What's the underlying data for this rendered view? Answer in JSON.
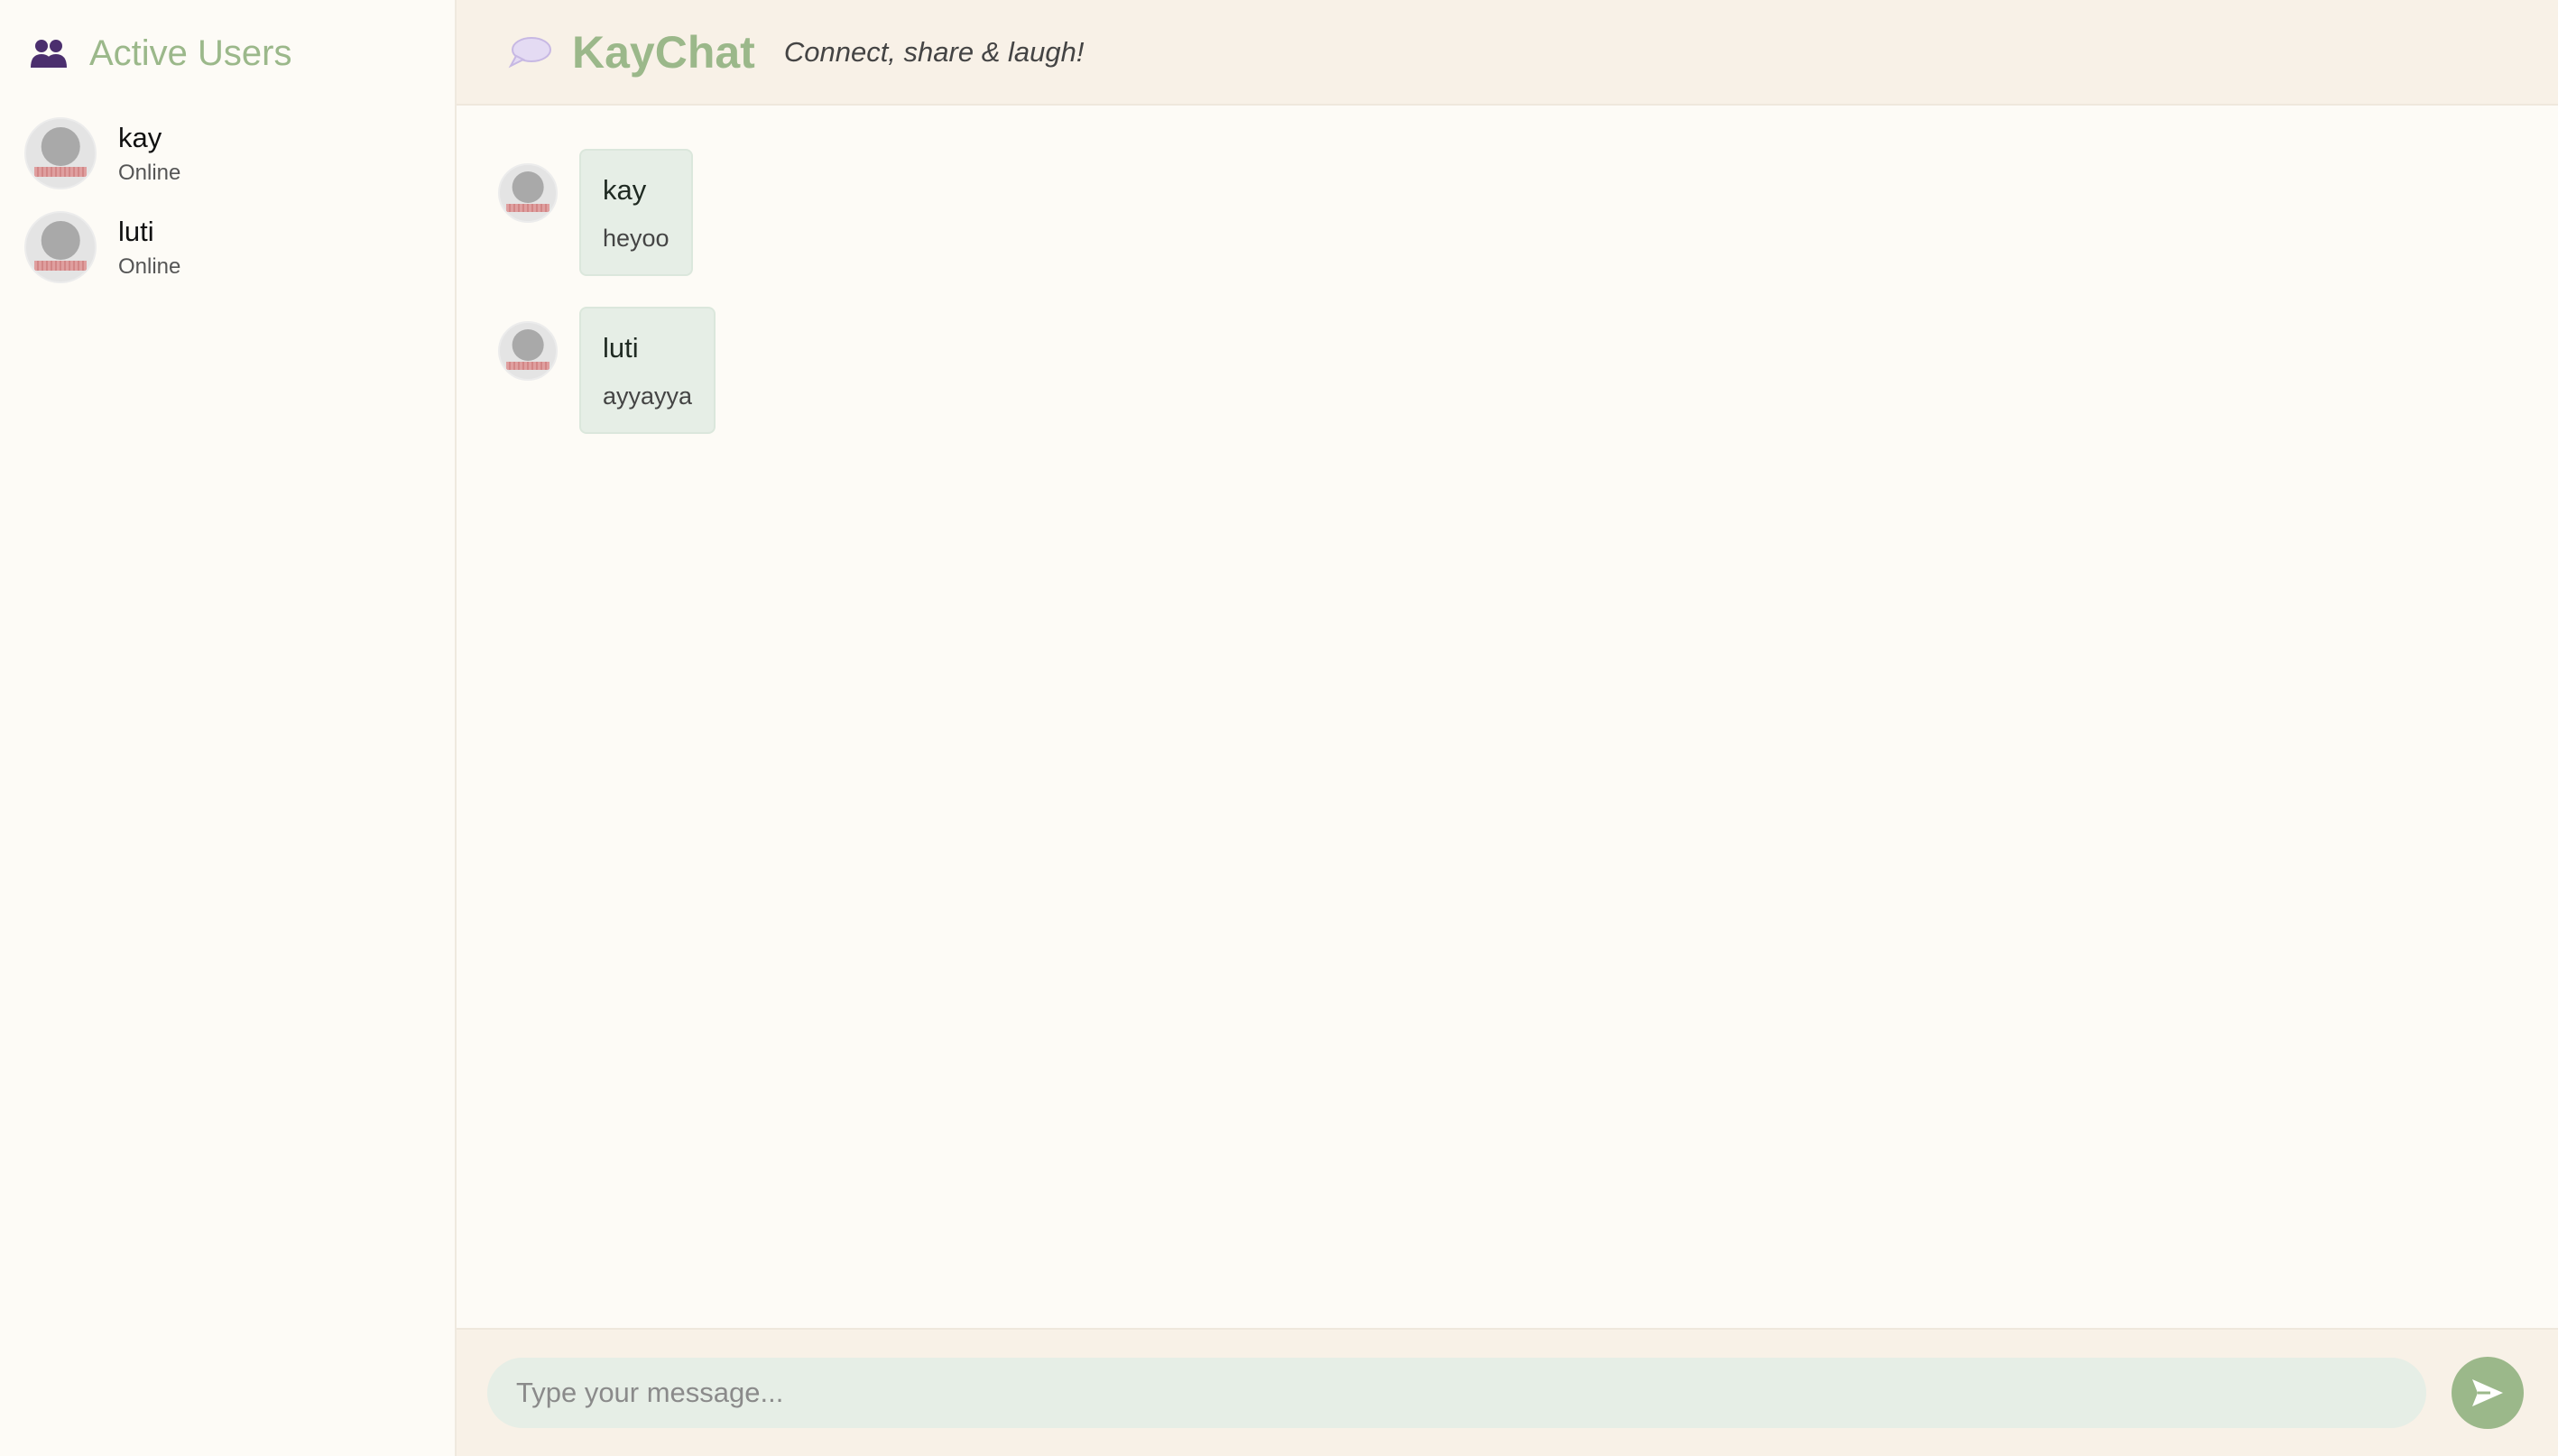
{
  "sidebar": {
    "title": "Active Users",
    "users": [
      {
        "name": "kay",
        "status": "Online"
      },
      {
        "name": "luti",
        "status": "Online"
      }
    ]
  },
  "header": {
    "title": "KayChat",
    "tagline": "Connect, share & laugh!"
  },
  "messages": [
    {
      "author": "kay",
      "text": "heyoo"
    },
    {
      "author": "luti",
      "text": "ayyayya"
    }
  ],
  "composer": {
    "placeholder": "Type your message...",
    "send_icon": "send-icon"
  },
  "colors": {
    "accent": "#9bb88a",
    "bubble": "#e6eee6",
    "header_bg": "#f8f1e7",
    "users_icon": "#4b2f6e",
    "chat_icon": "#d6c8ee"
  }
}
